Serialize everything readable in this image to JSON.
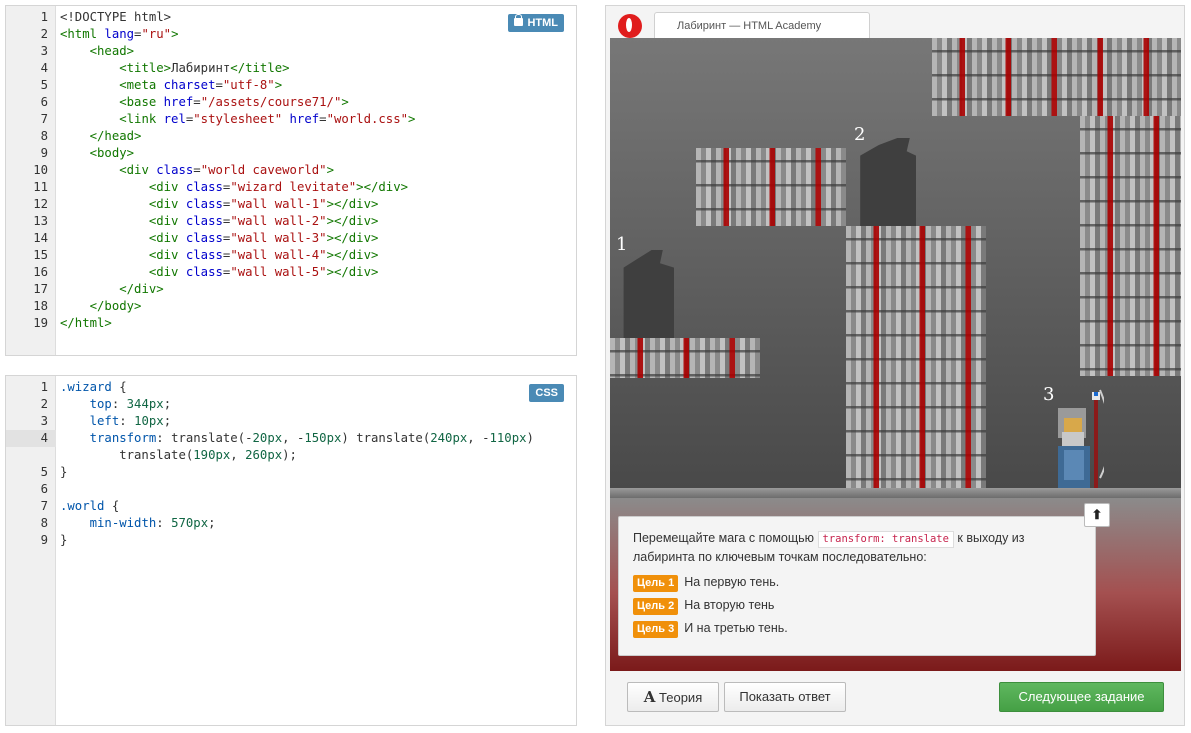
{
  "html_editor": {
    "badge": "HTML",
    "lines": [
      {
        "n": "1",
        "parts": [
          [
            "t-plain",
            "<!DOCTYPE html>"
          ]
        ]
      },
      {
        "n": "2",
        "parts": [
          [
            "t-tag",
            "<html "
          ],
          [
            "t-att",
            "lang"
          ],
          [
            "t-plain",
            "="
          ],
          [
            "t-str",
            "\"ru\""
          ],
          [
            "t-tag",
            ">"
          ]
        ]
      },
      {
        "n": "3",
        "parts": [
          [
            "t-plain",
            "    "
          ],
          [
            "t-tag",
            "<head>"
          ]
        ]
      },
      {
        "n": "4",
        "parts": [
          [
            "t-plain",
            "        "
          ],
          [
            "t-tag",
            "<title>"
          ],
          [
            "t-plain",
            "Лабиринт"
          ],
          [
            "t-tag",
            "</title>"
          ]
        ]
      },
      {
        "n": "5",
        "parts": [
          [
            "t-plain",
            "        "
          ],
          [
            "t-tag",
            "<meta "
          ],
          [
            "t-att",
            "charset"
          ],
          [
            "t-plain",
            "="
          ],
          [
            "t-str",
            "\"utf-8\""
          ],
          [
            "t-tag",
            ">"
          ]
        ]
      },
      {
        "n": "6",
        "parts": [
          [
            "t-plain",
            "        "
          ],
          [
            "t-tag",
            "<base "
          ],
          [
            "t-att",
            "href"
          ],
          [
            "t-plain",
            "="
          ],
          [
            "t-str",
            "\"/assets/course71/\""
          ],
          [
            "t-tag",
            ">"
          ]
        ]
      },
      {
        "n": "7",
        "parts": [
          [
            "t-plain",
            "        "
          ],
          [
            "t-tag",
            "<link "
          ],
          [
            "t-att",
            "rel"
          ],
          [
            "t-plain",
            "="
          ],
          [
            "t-str",
            "\"stylesheet\""
          ],
          [
            "t-plain",
            " "
          ],
          [
            "t-att",
            "href"
          ],
          [
            "t-plain",
            "="
          ],
          [
            "t-str",
            "\"world.css\""
          ],
          [
            "t-tag",
            ">"
          ]
        ]
      },
      {
        "n": "8",
        "parts": [
          [
            "t-plain",
            "    "
          ],
          [
            "t-tag",
            "</head>"
          ]
        ]
      },
      {
        "n": "9",
        "parts": [
          [
            "t-plain",
            "    "
          ],
          [
            "t-tag",
            "<body>"
          ]
        ]
      },
      {
        "n": "10",
        "parts": [
          [
            "t-plain",
            "        "
          ],
          [
            "t-tag",
            "<div "
          ],
          [
            "t-att",
            "class"
          ],
          [
            "t-plain",
            "="
          ],
          [
            "t-str",
            "\"world caveworld\""
          ],
          [
            "t-tag",
            ">"
          ]
        ]
      },
      {
        "n": "11",
        "parts": [
          [
            "t-plain",
            "            "
          ],
          [
            "t-tag",
            "<div "
          ],
          [
            "t-att",
            "class"
          ],
          [
            "t-plain",
            "="
          ],
          [
            "t-str",
            "\"wizard levitate\""
          ],
          [
            "t-tag",
            "></div>"
          ]
        ]
      },
      {
        "n": "12",
        "parts": [
          [
            "t-plain",
            "            "
          ],
          [
            "t-tag",
            "<div "
          ],
          [
            "t-att",
            "class"
          ],
          [
            "t-plain",
            "="
          ],
          [
            "t-str",
            "\"wall wall-1\""
          ],
          [
            "t-tag",
            "></div>"
          ]
        ]
      },
      {
        "n": "13",
        "parts": [
          [
            "t-plain",
            "            "
          ],
          [
            "t-tag",
            "<div "
          ],
          [
            "t-att",
            "class"
          ],
          [
            "t-plain",
            "="
          ],
          [
            "t-str",
            "\"wall wall-2\""
          ],
          [
            "t-tag",
            "></div>"
          ]
        ]
      },
      {
        "n": "14",
        "parts": [
          [
            "t-plain",
            "            "
          ],
          [
            "t-tag",
            "<div "
          ],
          [
            "t-att",
            "class"
          ],
          [
            "t-plain",
            "="
          ],
          [
            "t-str",
            "\"wall wall-3\""
          ],
          [
            "t-tag",
            "></div>"
          ]
        ]
      },
      {
        "n": "15",
        "parts": [
          [
            "t-plain",
            "            "
          ],
          [
            "t-tag",
            "<div "
          ],
          [
            "t-att",
            "class"
          ],
          [
            "t-plain",
            "="
          ],
          [
            "t-str",
            "\"wall wall-4\""
          ],
          [
            "t-tag",
            "></div>"
          ]
        ]
      },
      {
        "n": "16",
        "parts": [
          [
            "t-plain",
            "            "
          ],
          [
            "t-tag",
            "<div "
          ],
          [
            "t-att",
            "class"
          ],
          [
            "t-plain",
            "="
          ],
          [
            "t-str",
            "\"wall wall-5\""
          ],
          [
            "t-tag",
            "></div>"
          ]
        ]
      },
      {
        "n": "17",
        "parts": [
          [
            "t-plain",
            "        "
          ],
          [
            "t-tag",
            "</div>"
          ]
        ]
      },
      {
        "n": "18",
        "parts": [
          [
            "t-plain",
            "    "
          ],
          [
            "t-tag",
            "</body>"
          ]
        ]
      },
      {
        "n": "19",
        "parts": [
          [
            "t-tag",
            "</html>"
          ]
        ]
      }
    ]
  },
  "css_editor": {
    "badge": "CSS",
    "lines": [
      {
        "n": "1",
        "parts": [
          [
            "t-sel",
            ".wizard"
          ],
          [
            "t-plain",
            " {"
          ]
        ]
      },
      {
        "n": "2",
        "parts": [
          [
            "t-plain",
            "    "
          ],
          [
            "t-prop",
            "top"
          ],
          [
            "t-plain",
            ": "
          ],
          [
            "t-num",
            "344px"
          ],
          [
            "t-plain",
            ";"
          ]
        ]
      },
      {
        "n": "3",
        "parts": [
          [
            "t-plain",
            "    "
          ],
          [
            "t-prop",
            "left"
          ],
          [
            "t-plain",
            ": "
          ],
          [
            "t-num",
            "10px"
          ],
          [
            "t-plain",
            ";"
          ]
        ]
      },
      {
        "n": "4",
        "active": true,
        "parts": [
          [
            "t-plain",
            "    "
          ],
          [
            "t-prop",
            "transform"
          ],
          [
            "t-plain",
            ": translate(-"
          ],
          [
            "t-num",
            "20px"
          ],
          [
            "t-plain",
            ", -"
          ],
          [
            "t-num",
            "150px"
          ],
          [
            "t-plain",
            ") translate("
          ],
          [
            "t-num",
            "240px"
          ],
          [
            "t-plain",
            ", -"
          ],
          [
            "t-num",
            "110px"
          ],
          [
            "t-plain",
            ")"
          ]
        ]
      },
      {
        "n": "",
        "active": true,
        "parts": [
          [
            "t-plain",
            "        translate("
          ],
          [
            "t-num",
            "190px"
          ],
          [
            "t-plain",
            ", "
          ],
          [
            "t-num",
            "260px"
          ],
          [
            "t-plain",
            ");"
          ]
        ]
      },
      {
        "n": "5",
        "parts": [
          [
            "t-plain",
            "}"
          ]
        ]
      },
      {
        "n": "6",
        "parts": [
          [
            "t-plain",
            ""
          ]
        ]
      },
      {
        "n": "7",
        "parts": [
          [
            "t-sel",
            ".world"
          ],
          [
            "t-plain",
            " {"
          ]
        ]
      },
      {
        "n": "8",
        "parts": [
          [
            "t-plain",
            "    "
          ],
          [
            "t-prop",
            "min-width"
          ],
          [
            "t-plain",
            ": "
          ],
          [
            "t-num",
            "570px"
          ],
          [
            "t-plain",
            ";"
          ]
        ]
      },
      {
        "n": "9",
        "parts": [
          [
            "t-plain",
            "}"
          ]
        ]
      }
    ]
  },
  "browser": {
    "tab_title": "Лабиринт — HTML Academy"
  },
  "game": {
    "markers": [
      "1",
      "2",
      "3"
    ]
  },
  "task": {
    "text_before": "Перемещайте мага с помощью ",
    "code": "transform: translate",
    "text_after": " к выходу из лабиринта по ключевым точкам последовательно:",
    "up_button": "⬆",
    "goals": [
      {
        "label": "Цель 1",
        "text": "На первую тень."
      },
      {
        "label": "Цель 2",
        "text": "На вторую тень"
      },
      {
        "label": "Цель 3",
        "text": "И на третью тень."
      }
    ]
  },
  "buttons": {
    "theory_icon": "A",
    "theory": "Теория",
    "answer": "Показать ответ",
    "next": "Следующее задание"
  },
  "colors": {
    "badge_bg": "#4a8ab5",
    "goal_badge": "#f0900a",
    "next_button": "#4fa94f",
    "opera_red": "#e01d1d"
  }
}
